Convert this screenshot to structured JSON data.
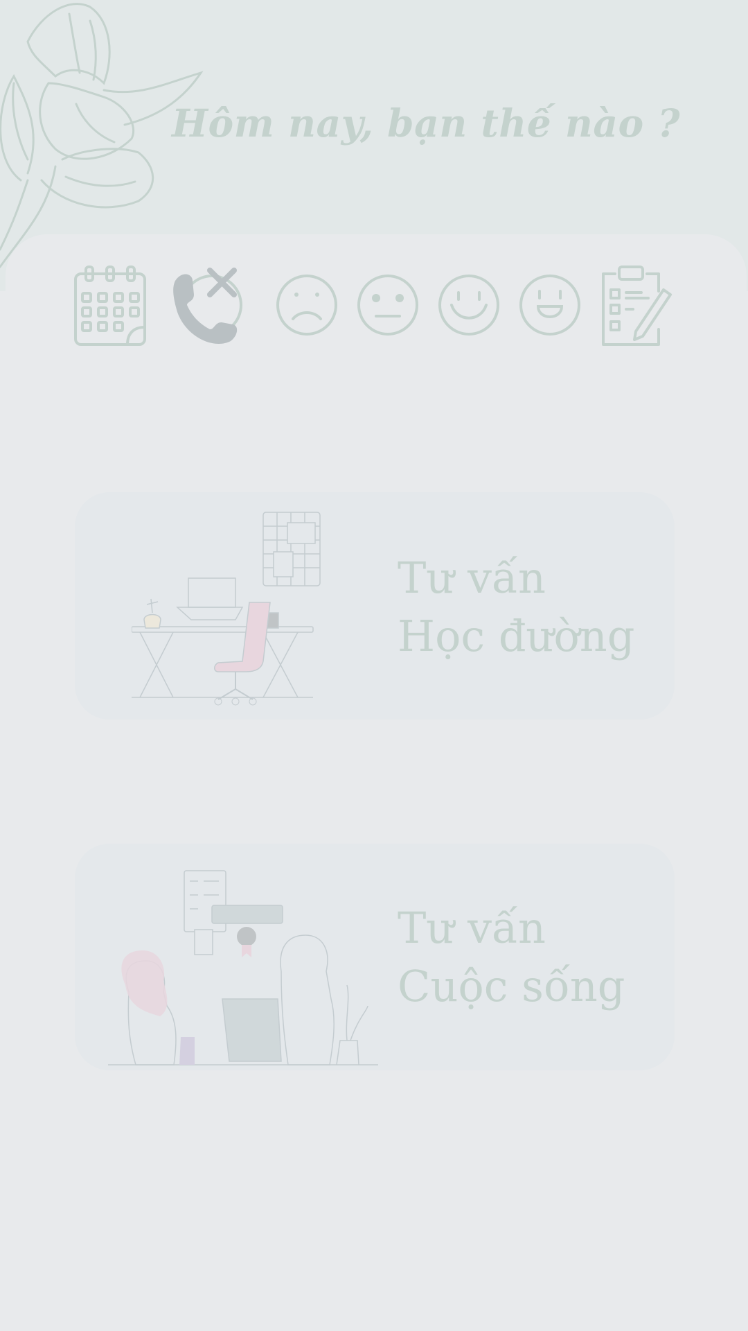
{
  "header": {
    "greeting": "Hôm nay, bạn thế nào ?"
  },
  "mood_bar": {
    "icons": [
      {
        "name": "calendar-icon"
      },
      {
        "name": "hang-up-call-icon"
      },
      {
        "name": "sad-face-icon"
      },
      {
        "name": "neutral-face-icon"
      },
      {
        "name": "smiling-face-icon"
      },
      {
        "name": "happy-face-icon"
      },
      {
        "name": "clipboard-checklist-icon"
      }
    ]
  },
  "cards": [
    {
      "line1": "Tư vấn",
      "line2": "Học đường",
      "illustration": "study-desk-illustration"
    },
    {
      "line1": "Tư vấn",
      "line2": "Cuộc sống",
      "illustration": "counseling-conversation-illustration"
    }
  ],
  "colors": {
    "top_background": "#e2e8e8",
    "page_background": "#e8eaec",
    "card_background": "#e4e8eb",
    "text_and_icons": "#c4d2cd",
    "accent_pink": "#e8d6de"
  }
}
